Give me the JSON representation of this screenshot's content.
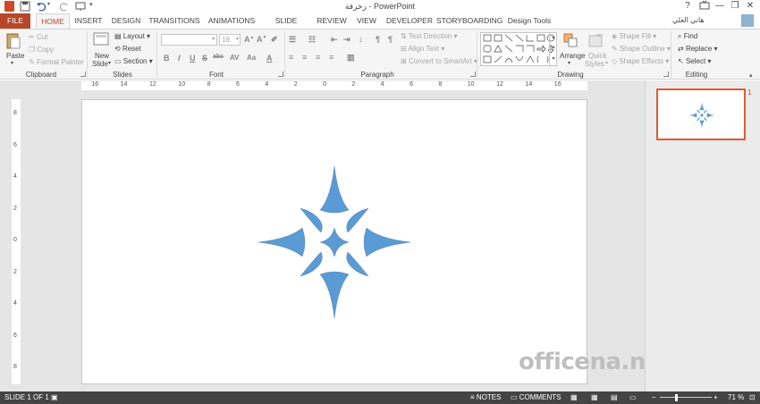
{
  "window": {
    "title": "زخرفة - PowerPoint",
    "help": "?",
    "minimize": "—",
    "restore": "❐",
    "close": "✕",
    "user_name": "هاني العلي"
  },
  "tabs": [
    "FILE",
    "HOME",
    "INSERT",
    "DESIGN",
    "TRANSITIONS",
    "ANIMATIONS",
    "SLIDE SHOW",
    "REVIEW",
    "VIEW",
    "DEVELOPER",
    "STORYBOARDING",
    "Design Tools"
  ],
  "clipboard": {
    "paste": "Paste",
    "cut": "Cut",
    "copy": "Copy",
    "format_painter": "Format Painter",
    "label": "Clipboard"
  },
  "slides": {
    "new_slide_1": "New",
    "new_slide_2": "Slide",
    "layout": "Layout",
    "reset": "Reset",
    "section": "Section",
    "label": "Slides"
  },
  "font": {
    "size": "18",
    "bold": "B",
    "italic": "I",
    "underline": "U",
    "strike": "S",
    "shadow": "abc",
    "spacing": "AV",
    "case": "Aa",
    "color": "A",
    "label": "Font"
  },
  "paragraph": {
    "text_direction": "Text Direction",
    "align_text": "Align Text",
    "convert_smartart": "Convert to SmartArt",
    "label": "Paragraph"
  },
  "drawing": {
    "arrange": "Arrange",
    "quick_styles_1": "Quick",
    "quick_styles_2": "Styles",
    "shape_fill": "Shape Fill",
    "shape_outline": "Shape Outline",
    "shape_effects": "Shape Effects",
    "label": "Drawing"
  },
  "editing": {
    "find": "Find",
    "replace": "Replace",
    "select": "Select",
    "label": "Editing"
  },
  "ruler": {
    "h_ticks": [
      "16",
      "14",
      "12",
      "10",
      "8",
      "6",
      "4",
      "2",
      "0",
      "2",
      "4",
      "6",
      "8",
      "10",
      "12",
      "14",
      "16"
    ],
    "v_ticks": [
      "8",
      "6",
      "4",
      "2",
      "0",
      "2",
      "4",
      "6",
      "8"
    ]
  },
  "thumbnail": {
    "number": "1"
  },
  "watermark": "officena.net",
  "status": {
    "slide_info": "SLIDE 1 OF 1",
    "notes": "NOTES",
    "comments": "COMMENTS",
    "zoom": "71 %",
    "minus": "−",
    "plus": "+"
  },
  "colors": {
    "accent": "#b7472a",
    "shape": "#5b9bd5",
    "status_bar": "#444444",
    "selection": "#e15a32"
  }
}
